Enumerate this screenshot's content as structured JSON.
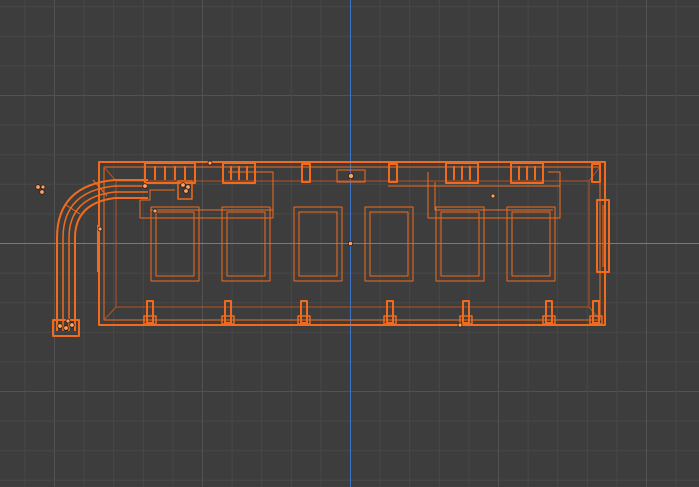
{
  "viewport": {
    "view": "top-orthographic",
    "shading": "wireframe",
    "colors": {
      "background": "#3d3d3d",
      "grid_minor": "#484848",
      "grid_major": "#525252",
      "x_axis": "#6a8f2e",
      "y_axis": "#3f74c4",
      "selection": "#f26b1d",
      "selection_dim": "#b5541e",
      "origin_fill": "#f5a36a"
    }
  },
  "scene": {
    "selected_object": "wireframe-model",
    "window_panes": 6,
    "pole_count": 7
  }
}
